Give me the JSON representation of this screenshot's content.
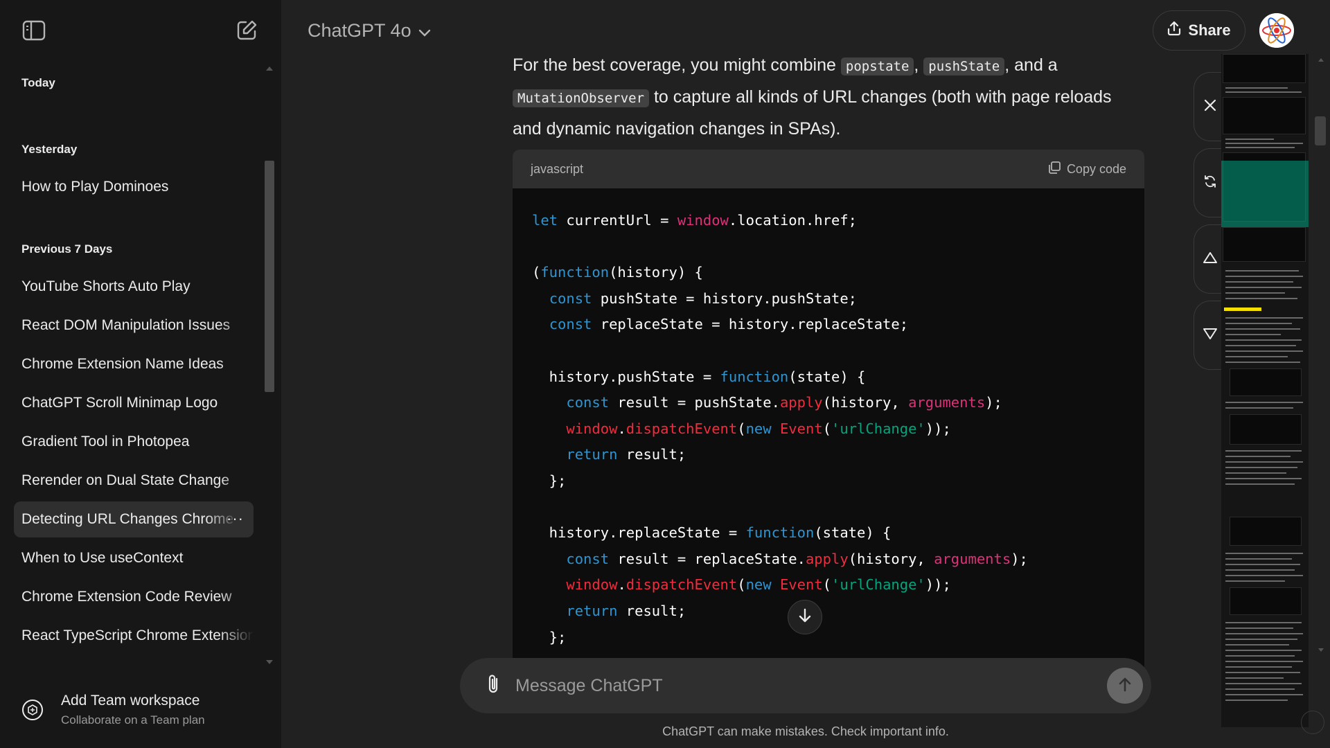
{
  "header": {
    "model_name": "ChatGPT 4o",
    "share_label": "Share"
  },
  "sidebar": {
    "sections": [
      {
        "title": "Today",
        "items": []
      },
      {
        "title": "Yesterday",
        "items": [
          {
            "label": "How to Play Dominoes"
          }
        ]
      },
      {
        "title": "Previous 7 Days",
        "items": [
          {
            "label": "YouTube Shorts Auto Play"
          },
          {
            "label": "React DOM Manipulation Issues"
          },
          {
            "label": "Chrome Extension Name Ideas"
          },
          {
            "label": "ChatGPT Scroll Minimap Logo"
          },
          {
            "label": "Gradient Tool in Photopea"
          },
          {
            "label": "Rerender on Dual State Change"
          },
          {
            "label": "Detecting URL Changes Chrome",
            "active": true
          },
          {
            "label": "When to Use useContext"
          },
          {
            "label": "Chrome Extension Code Review"
          },
          {
            "label": "React TypeScript Chrome Extension"
          }
        ]
      }
    ],
    "more_glyph": "···",
    "team": {
      "title": "Add Team workspace",
      "subtitle": "Collaborate on a Team plan"
    }
  },
  "message": {
    "intro_prefix": "For the best coverage, you might combine",
    "code_popstate": "popstate",
    "sep1": ",",
    "code_pushstate": "pushState",
    "sep2": ", and a",
    "code_mutation": "MutationObserver",
    "intro_suffix": "to capture all kinds of URL changes (both with page reloads",
    "intro_line3": "and dynamic navigation changes in SPAs)."
  },
  "code_block": {
    "language": "javascript",
    "copy_label": "Copy code"
  },
  "composer": {
    "placeholder": "Message ChatGPT",
    "disclaimer": "ChatGPT can make mistakes. Check important info."
  },
  "colors": {
    "background": "#212121",
    "sidebar": "#171717",
    "keyword": "#2e95d3",
    "function_call": "#f22c3d",
    "string": "#00a67d",
    "minimap_viewport": "#00a082",
    "minimap_marker": "#f5e000"
  }
}
